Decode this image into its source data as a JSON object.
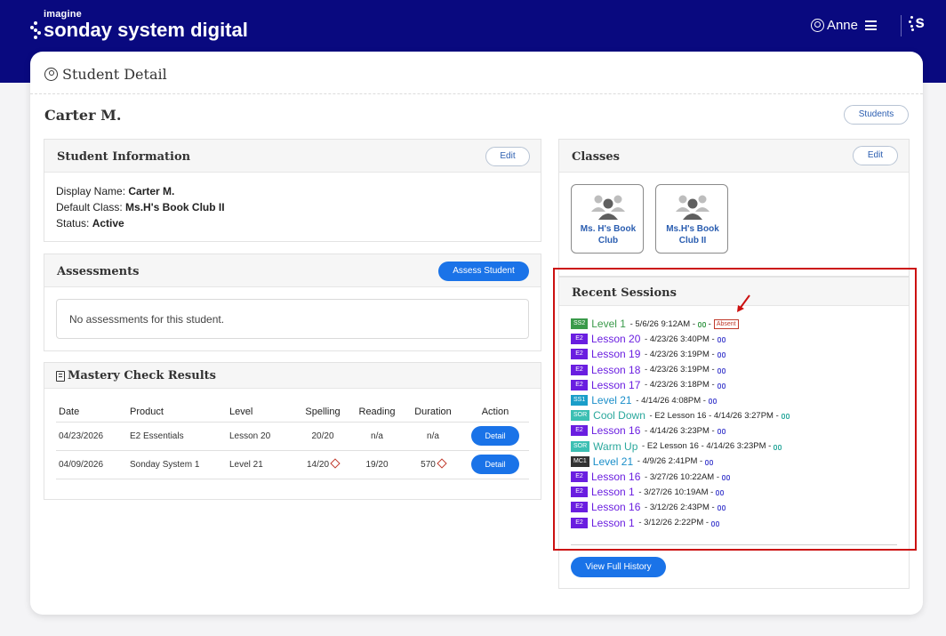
{
  "brand": {
    "small": "imagine",
    "main": "sonday system digital",
    "corner": "s"
  },
  "user": {
    "name": "Anne"
  },
  "page": {
    "title": "Student Detail",
    "student_name": "Carter M.",
    "students_button": "Students"
  },
  "student_info": {
    "title": "Student Information",
    "edit": "Edit",
    "display_name_label": "Display Name:",
    "display_name": "Carter M.",
    "default_class_label": "Default Class:",
    "default_class": "Ms.H's Book Club II",
    "status_label": "Status:",
    "status": "Active"
  },
  "assessments": {
    "title": "Assessments",
    "button": "Assess Student",
    "empty": "No assessments for this student."
  },
  "mastery": {
    "title": "Mastery Check Results",
    "headers": [
      "Date",
      "Product",
      "Level",
      "Spelling",
      "Reading",
      "Duration",
      "Action"
    ],
    "rows": [
      {
        "date": "04/23/2026",
        "product": "E2 Essentials",
        "level": "Lesson 20",
        "spelling": "20/20",
        "reading": "n/a",
        "duration": "n/a",
        "action": "Detail"
      },
      {
        "date": "04/09/2026",
        "product": "Sonday System 1",
        "level": "Level 21",
        "spelling": "14/20",
        "reading": "19/20",
        "duration": "570",
        "action": "Detail"
      }
    ]
  },
  "classes": {
    "title": "Classes",
    "edit": "Edit",
    "items": [
      {
        "name": "Ms. H's Book Club"
      },
      {
        "name": "Ms.H's Book Club II"
      }
    ]
  },
  "recent": {
    "title": "Recent Sessions",
    "button": "View Full History",
    "absent_label": "Absent",
    "sessions": [
      {
        "badge": "SS2",
        "badge_color": "#3a9a4a",
        "link": "Level 1",
        "link_color": "#3a9a4a",
        "sub": "",
        "time": "5/6/26 9:12AM",
        "absent": true
      },
      {
        "badge": "E2",
        "badge_color": "#6a1ee0",
        "link": "Lesson 20",
        "link_color": "#6a1ee0",
        "sub": "",
        "time": "4/23/26 3:40PM",
        "absent": false
      },
      {
        "badge": "E2",
        "badge_color": "#6a1ee0",
        "link": "Lesson 19",
        "link_color": "#6a1ee0",
        "sub": "",
        "time": "4/23/26 3:19PM",
        "absent": false
      },
      {
        "badge": "E2",
        "badge_color": "#6a1ee0",
        "link": "Lesson 18",
        "link_color": "#6a1ee0",
        "sub": "",
        "time": "4/23/26 3:19PM",
        "absent": false
      },
      {
        "badge": "E2",
        "badge_color": "#6a1ee0",
        "link": "Lesson 17",
        "link_color": "#6a1ee0",
        "sub": "",
        "time": "4/23/26 3:18PM",
        "absent": false
      },
      {
        "badge": "SS1",
        "badge_color": "#1a9ec9",
        "link": "Level 21",
        "link_color": "#1a8ec9",
        "sub": "",
        "time": "4/14/26 4:08PM",
        "absent": false
      },
      {
        "badge": "SOR",
        "badge_color": "#3cbfb3",
        "link": "Cool Down",
        "link_color": "#2aa89c",
        "sub": "E2 Lesson 16",
        "time": "4/14/26 3:27PM",
        "absent": false
      },
      {
        "badge": "E2",
        "badge_color": "#6a1ee0",
        "link": "Lesson 16",
        "link_color": "#6a1ee0",
        "sub": "",
        "time": "4/14/26 3:23PM",
        "absent": false
      },
      {
        "badge": "SOR",
        "badge_color": "#3cbfb3",
        "link": "Warm Up",
        "link_color": "#2aa89c",
        "sub": "E2 Lesson 16",
        "time": "4/14/26 3:23PM",
        "absent": false
      },
      {
        "badge": "MC1",
        "badge_color": "#333333",
        "link": "Level 21",
        "link_color": "#1a8ec9",
        "sub": "",
        "time": "4/9/26 2:41PM",
        "absent": false
      },
      {
        "badge": "E2",
        "badge_color": "#6a1ee0",
        "link": "Lesson 16",
        "link_color": "#6a1ee0",
        "sub": "",
        "time": "3/27/26 10:22AM",
        "absent": false
      },
      {
        "badge": "E2",
        "badge_color": "#6a1ee0",
        "link": "Lesson 1",
        "link_color": "#6a1ee0",
        "sub": "",
        "time": "3/27/26 10:19AM",
        "absent": false
      },
      {
        "badge": "E2",
        "badge_color": "#6a1ee0",
        "link": "Lesson 16",
        "link_color": "#6a1ee0",
        "sub": "",
        "time": "3/12/26 2:43PM",
        "absent": false
      },
      {
        "badge": "E2",
        "badge_color": "#6a1ee0",
        "link": "Lesson 1",
        "link_color": "#6a1ee0",
        "sub": "",
        "time": "3/12/26 2:22PM",
        "absent": false
      }
    ]
  },
  "colors": {
    "topbar": "#09097f",
    "primary_button": "#1a73e8",
    "highlight_box": "#cc1111"
  }
}
